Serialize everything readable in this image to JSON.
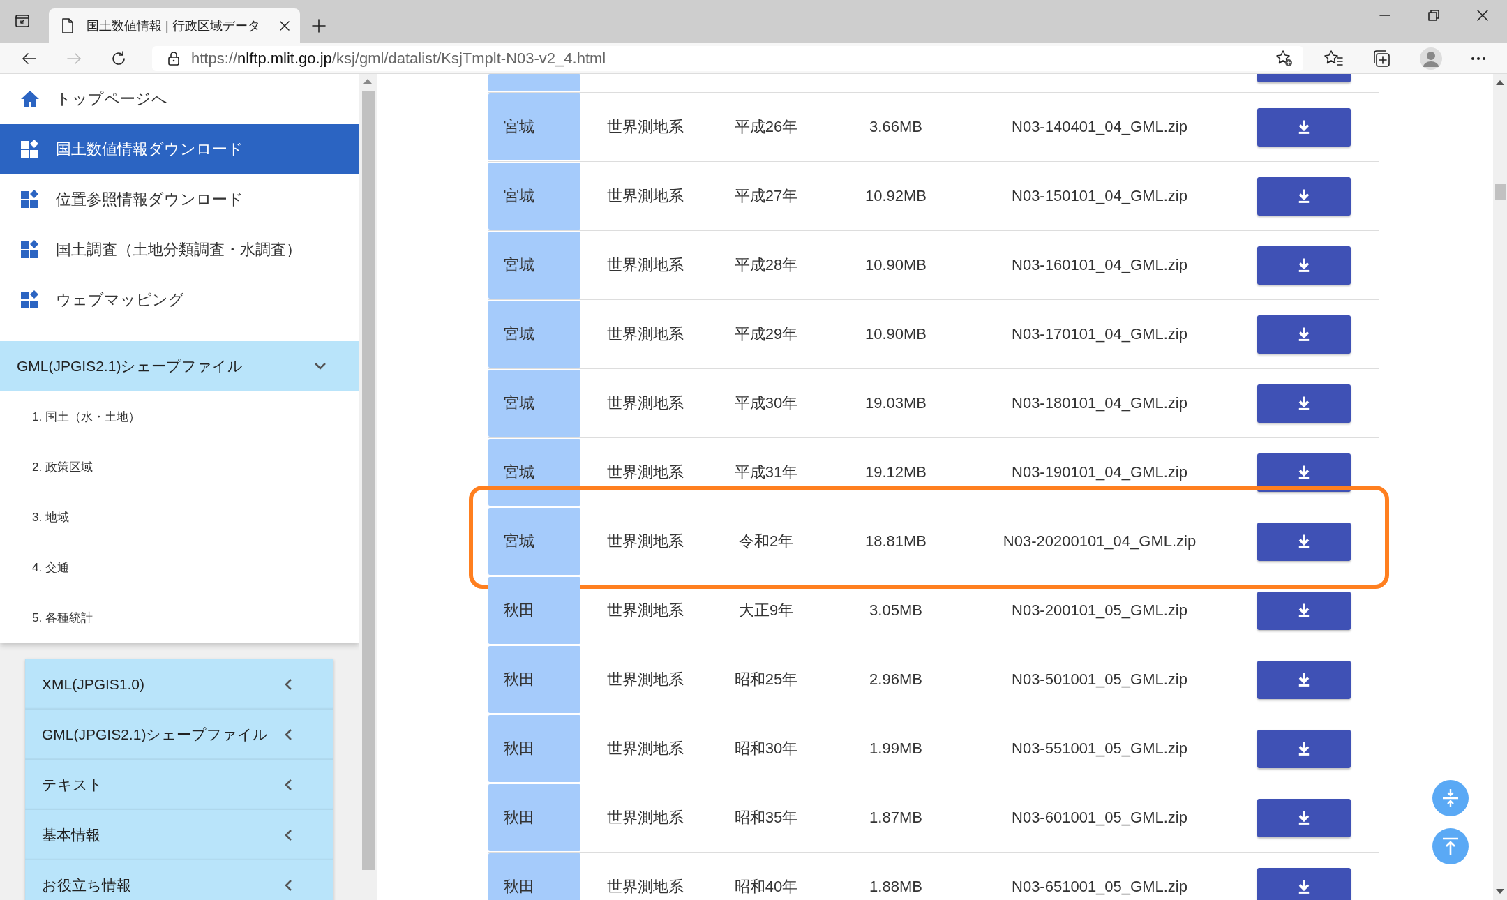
{
  "browser": {
    "tab_title": "国土数値情報 | 行政区域データ",
    "url_scheme": "https://",
    "url_host": "nlftp.mlit.go.jp",
    "url_path": "/ksj/gml/datalist/KsjTmplt-N03-v2_4.html"
  },
  "sidebar": {
    "nav": [
      {
        "label": "トップページへ",
        "kind": "home",
        "selected": false
      },
      {
        "label": "国土数値情報ダウンロード",
        "kind": "grid",
        "selected": true
      },
      {
        "label": "位置参照情報ダウンロード",
        "kind": "grid",
        "selected": false
      },
      {
        "label": "国土調査（土地分類調査・水調査）",
        "kind": "grid",
        "selected": false
      },
      {
        "label": "ウェブマッピング",
        "kind": "grid",
        "selected": false
      }
    ],
    "section": {
      "title": "GML(JPGIS2.1)シェープファイル",
      "expanded": true,
      "items": [
        "1. 国土（水・土地）",
        "2. 政策区域",
        "3. 地域",
        "4. 交通",
        "5. 各種統計"
      ]
    },
    "accordion": [
      {
        "label": "XML(JPGIS1.0)",
        "expanded": false
      },
      {
        "label": "GML(JPGIS2.1)シェープファイル",
        "expanded": false
      },
      {
        "label": "テキスト",
        "expanded": false
      },
      {
        "label": "基本情報",
        "expanded": false
      },
      {
        "label": "お役立ち情報",
        "expanded": false
      }
    ]
  },
  "table": {
    "rows": [
      {
        "prefecture": "宮城",
        "datum": "世界測地系",
        "year": "平成26年",
        "size": "3.66MB",
        "file": "N03-140401_04_GML.zip",
        "highlighted": false
      },
      {
        "prefecture": "宮城",
        "datum": "世界測地系",
        "year": "平成27年",
        "size": "10.92MB",
        "file": "N03-150101_04_GML.zip",
        "highlighted": false
      },
      {
        "prefecture": "宮城",
        "datum": "世界測地系",
        "year": "平成28年",
        "size": "10.90MB",
        "file": "N03-160101_04_GML.zip",
        "highlighted": false
      },
      {
        "prefecture": "宮城",
        "datum": "世界測地系",
        "year": "平成29年",
        "size": "10.90MB",
        "file": "N03-170101_04_GML.zip",
        "highlighted": false
      },
      {
        "prefecture": "宮城",
        "datum": "世界測地系",
        "year": "平成30年",
        "size": "19.03MB",
        "file": "N03-180101_04_GML.zip",
        "highlighted": false
      },
      {
        "prefecture": "宮城",
        "datum": "世界測地系",
        "year": "平成31年",
        "size": "19.12MB",
        "file": "N03-190101_04_GML.zip",
        "highlighted": false
      },
      {
        "prefecture": "宮城",
        "datum": "世界測地系",
        "year": "令和2年",
        "size": "18.81MB",
        "file": "N03-20200101_04_GML.zip",
        "highlighted": true
      },
      {
        "prefecture": "秋田",
        "datum": "世界測地系",
        "year": "大正9年",
        "size": "3.05MB",
        "file": "N03-200101_05_GML.zip",
        "highlighted": false
      },
      {
        "prefecture": "秋田",
        "datum": "世界測地系",
        "year": "昭和25年",
        "size": "2.96MB",
        "file": "N03-501001_05_GML.zip",
        "highlighted": false
      },
      {
        "prefecture": "秋田",
        "datum": "世界測地系",
        "year": "昭和30年",
        "size": "1.99MB",
        "file": "N03-551001_05_GML.zip",
        "highlighted": false
      },
      {
        "prefecture": "秋田",
        "datum": "世界測地系",
        "year": "昭和35年",
        "size": "1.87MB",
        "file": "N03-601001_05_GML.zip",
        "highlighted": false
      },
      {
        "prefecture": "秋田",
        "datum": "世界測地系",
        "year": "昭和40年",
        "size": "1.88MB",
        "file": "N03-651001_05_GML.zip",
        "highlighted": false
      }
    ]
  }
}
